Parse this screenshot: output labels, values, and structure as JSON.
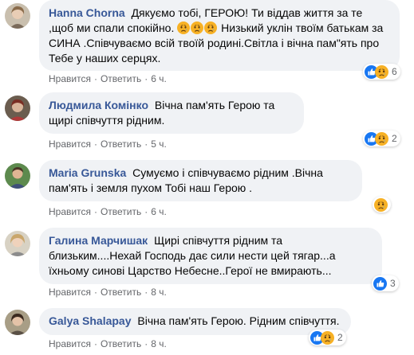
{
  "comments": [
    {
      "author": "Hanna Chorna",
      "text_before": "Дякуємо тобі, ГЕРОЮ! Ти віддав життя за те ,щоб ми спали спокійно.",
      "text_after": " Низький уклін твоїм батькам за СИНА .Співчуваємо всій твоїй родині.Світла і вічна пам\"ять про Тебе у наших серцях.",
      "inline_emoji": [
        "sad-face",
        "sad-face",
        "sad-face"
      ],
      "like": "Нравится",
      "reply": "Ответить",
      "time": "6 ч.",
      "reactions": [
        "like",
        "sad"
      ],
      "reaction_count": "6"
    },
    {
      "author": "Людмила Комінко",
      "text": "Вічна пам'ять Герою та щирі співчуття рідним.",
      "like": "Нравится",
      "reply": "Ответить",
      "time": "5 ч.",
      "reactions": [
        "like",
        "sad"
      ],
      "reaction_count": "2"
    },
    {
      "author": "Maria Grunska",
      "text": "Сумуємо і співчуваємо рідним .Вічна пам'ять і земля пухом Тобі наш Герою .",
      "like": "Нравится",
      "reply": "Ответить",
      "time": "6 ч.",
      "reactions": [
        "sad"
      ],
      "reaction_count": ""
    },
    {
      "author": "Галина Марчишак",
      "text": "Щирі співчуття рідним та близьким....Нехай Господь дає сили нести цей тягар...а їхньому синові Царство Небесне..Герої не вмирають...",
      "like": "Нравится",
      "reply": "Ответить",
      "time": "8 ч.",
      "reactions": [
        "like"
      ],
      "reaction_count": "3"
    },
    {
      "author": "Galya Shalapay",
      "text": "Вічна пам'ять Герою. Рідним співчуття.",
      "like": "Нравится",
      "reply": "Ответить",
      "time": "8 ч.",
      "reactions": [
        "like",
        "sad"
      ],
      "reaction_count": "2"
    }
  ],
  "separator": "·",
  "colors": {
    "author": "#385898",
    "bubble": "#f0f2f5",
    "meta": "#65676b",
    "like_blue": "#1877f2",
    "sad_yellow": "#f7b125"
  }
}
